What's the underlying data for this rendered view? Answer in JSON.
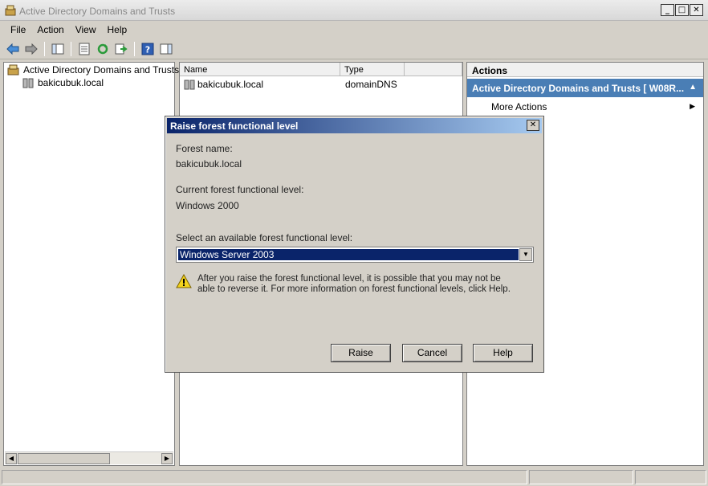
{
  "window": {
    "title": "Active Directory Domains and Trusts"
  },
  "menu": [
    "File",
    "Action",
    "View",
    "Help"
  ],
  "tree": {
    "root": "Active Directory Domains and Trusts [ \\",
    "child": "bakicubuk.local"
  },
  "list": {
    "headers": [
      "Name",
      "Type"
    ],
    "rows": [
      {
        "name": "bakicubuk.local",
        "type": "domainDNS"
      }
    ]
  },
  "actions": {
    "header": "Actions",
    "section": "Active Directory Domains and Trusts [ W08R...",
    "item": "More Actions"
  },
  "dialog": {
    "title": "Raise forest functional level",
    "forest_name_label": "Forest name:",
    "forest_name": "bakicubuk.local",
    "current_level_label": "Current forest functional level:",
    "current_level": "Windows 2000",
    "select_label": "Select an available forest functional level:",
    "selected_level": "Windows Server 2003",
    "warning": "After you raise the forest functional level, it is possible that you may not be able to reverse it. For more information on forest functional levels, click Help.",
    "buttons": {
      "raise": "Raise",
      "cancel": "Cancel",
      "help": "Help"
    }
  }
}
